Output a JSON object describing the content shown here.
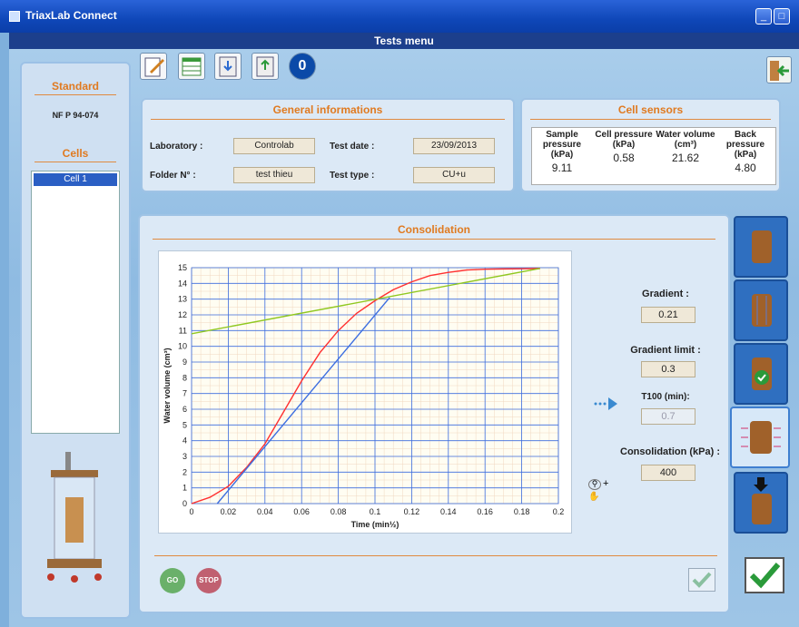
{
  "window": {
    "title": "TriaxLab Connect",
    "menu": "Tests menu"
  },
  "left": {
    "standard_label": "Standard",
    "standard_value": "NF P 94-074",
    "cells_label": "Cells",
    "cells": [
      "Cell 1"
    ]
  },
  "toolbar": {
    "icons": [
      "edit-icon",
      "table-icon",
      "save-icon",
      "load-icon",
      "zero-icon"
    ],
    "zero_label": "0"
  },
  "general": {
    "title": "General informations",
    "laboratory_label": "Laboratory :",
    "laboratory_value": "Controlab",
    "test_date_label": "Test date :",
    "test_date_value": "23/09/2013",
    "folder_label": "Folder N° :",
    "folder_value": "test thieu",
    "test_type_label": "Test type :",
    "test_type_value": "CU+u"
  },
  "sensors": {
    "title": "Cell sensors",
    "columns": [
      {
        "header": "Sample pressure (kPa)",
        "value": "9.11"
      },
      {
        "header": "Cell pressure (kPa)",
        "value": "0.58"
      },
      {
        "header": "Water volume (cm³)",
        "value": "21.62"
      },
      {
        "header": "Back pressure (kPa)",
        "value": "4.80"
      }
    ]
  },
  "consolidation": {
    "title": "Consolidation",
    "gradient_label": "Gradient :",
    "gradient_value": "0.21",
    "gradient_limit_label": "Gradient limit :",
    "gradient_limit_value": "0.3",
    "t100_label": "T100 (min):",
    "t100_value": "0.7",
    "consolidation_label": "Consolidation (kPa) :",
    "consolidation_value": "400",
    "go_label": "GO",
    "stop_label": "STOP"
  },
  "colors": {
    "accent": "#e07a20",
    "curve": "#ff3030",
    "tangent": "#90c820",
    "fit": "#3c6ee0"
  },
  "chart_data": {
    "type": "line",
    "xlabel": "Time (min½)",
    "ylabel": "Water volume (cm³)",
    "xlim": [
      0,
      0.2
    ],
    "ylim": [
      0,
      15
    ],
    "xticks": [
      "0",
      "0.02",
      "0.04",
      "0.06",
      "0.08",
      "0.1",
      "0.12",
      "0.14",
      "0.16",
      "0.18",
      "0.2"
    ],
    "yticks": [
      "0",
      "1",
      "2",
      "3",
      "4",
      "5",
      "6",
      "7",
      "8",
      "9",
      "10",
      "11",
      "12",
      "13",
      "14",
      "15"
    ],
    "grid": true,
    "series": [
      {
        "x": [
          0,
          0.01,
          0.02,
          0.03,
          0.04,
          0.05,
          0.06,
          0.07,
          0.08,
          0.09,
          0.1,
          0.11,
          0.12,
          0.13,
          0.14,
          0.15,
          0.16,
          0.17,
          0.18,
          0.19
        ],
        "y": [
          0,
          0.4,
          1.1,
          2.3,
          3.8,
          5.8,
          7.8,
          9.6,
          11.0,
          12.1,
          12.9,
          13.6,
          14.1,
          14.5,
          14.7,
          14.85,
          14.9,
          14.92,
          14.93,
          14.95
        ]
      },
      {
        "x": [
          0,
          0.19
        ],
        "y": [
          10.8,
          14.95
        ]
      },
      {
        "x": [
          0.014,
          0.108
        ],
        "y": [
          0,
          13.1
        ]
      }
    ]
  }
}
